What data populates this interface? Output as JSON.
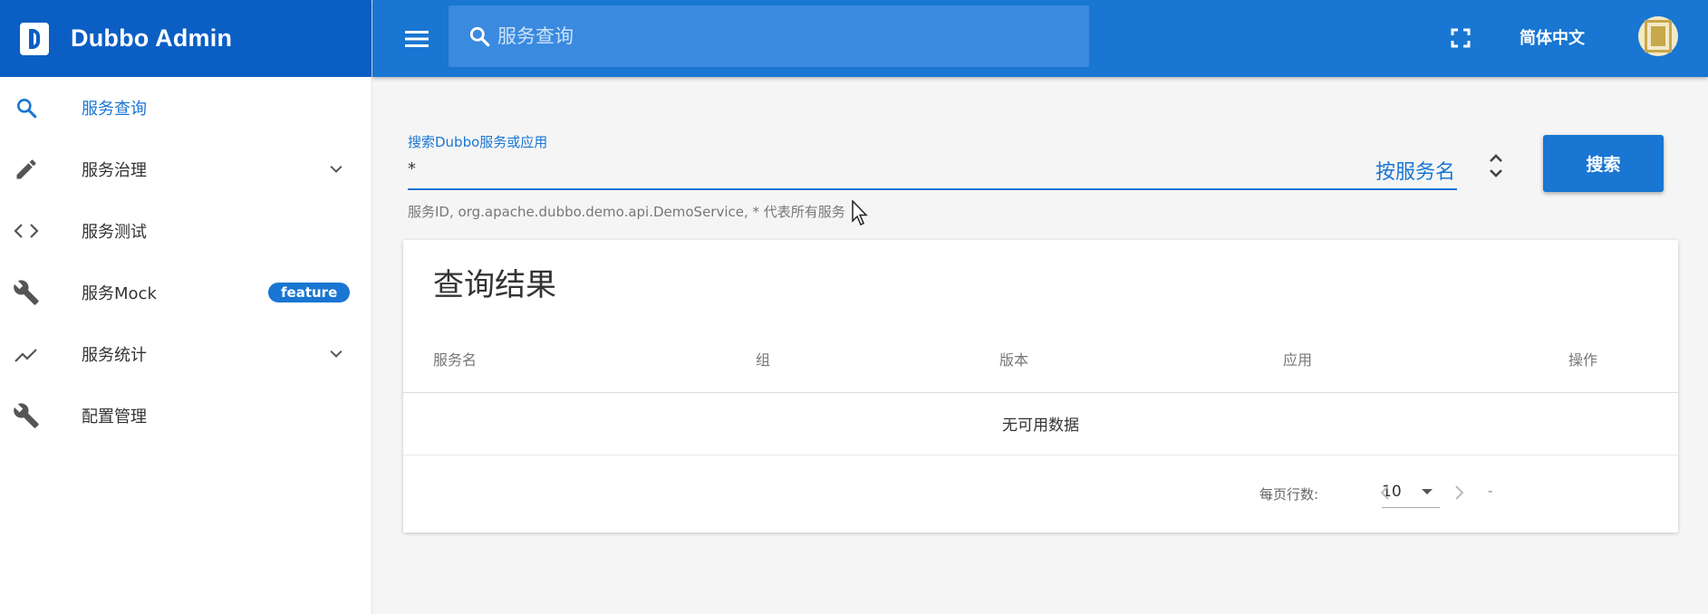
{
  "app": {
    "title": "Dubbo Admin"
  },
  "sidebar": {
    "items": [
      {
        "label": "服务查询",
        "icon": "search-icon",
        "active": true
      },
      {
        "label": "服务治理",
        "icon": "pencil-icon",
        "expandable": true
      },
      {
        "label": "服务测试",
        "icon": "code-icon"
      },
      {
        "label": "服务Mock",
        "icon": "wrench-icon",
        "badge": "feature"
      },
      {
        "label": "服务统计",
        "icon": "trend-icon",
        "expandable": true
      },
      {
        "label": "配置管理",
        "icon": "wrench-icon"
      }
    ]
  },
  "topbar": {
    "search_placeholder": "服务查询",
    "language": "简体中文",
    "icons": [
      "menu-icon",
      "search-icon",
      "fullscreen-icon",
      "avatar"
    ]
  },
  "search": {
    "label": "搜索Dubbo服务或应用",
    "value": "*",
    "mode": "按服务名",
    "hint": "服务ID, org.apache.dubbo.demo.api.DemoService, * 代表所有服务",
    "button": "搜索"
  },
  "results": {
    "title": "查询结果",
    "columns": [
      "服务名",
      "组",
      "版本",
      "应用",
      "操作"
    ],
    "empty_text": "无可用数据",
    "footer": {
      "rows_per_page_label": "每页行数:",
      "rows_per_page": "10",
      "range": "-"
    }
  },
  "colors": {
    "primary": "#1976d2",
    "brand_bar": "#0b5fc4",
    "search_box": "#3a8ae0"
  }
}
